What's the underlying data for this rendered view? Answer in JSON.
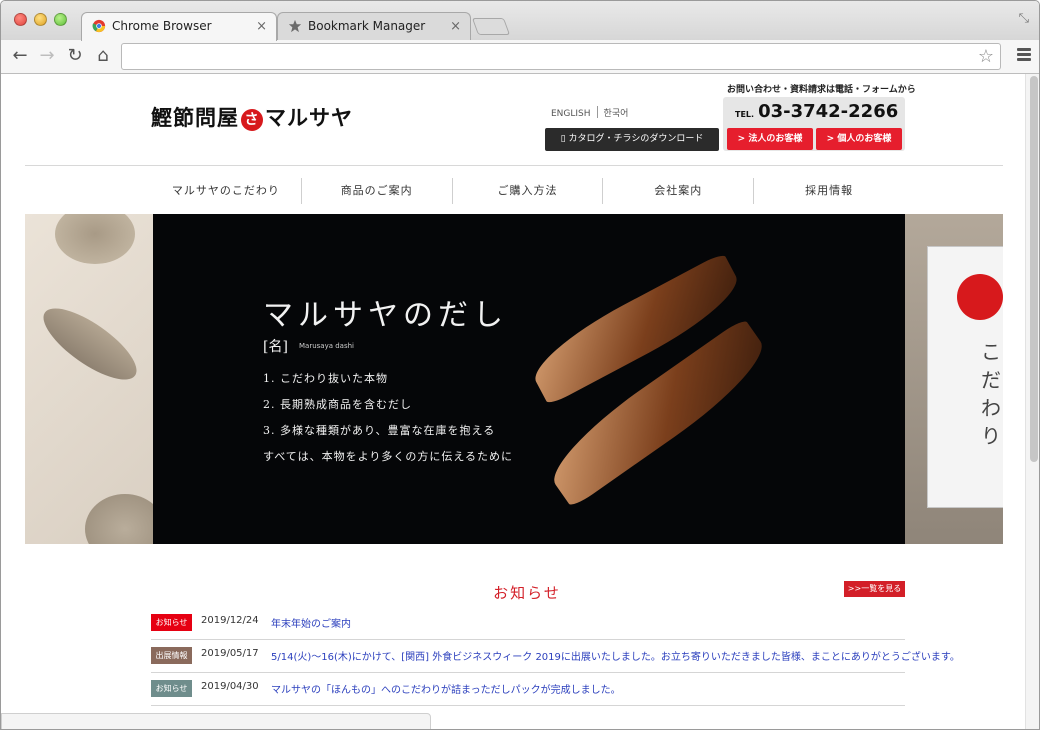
{
  "browser": {
    "tabs": [
      {
        "label": "Chrome Browser",
        "active": true
      },
      {
        "label": "Bookmark Manager",
        "active": false
      }
    ],
    "tab_close_glyph": "×",
    "url": "",
    "nav_icons": {
      "back": "←",
      "forward": "→",
      "reload": "↻",
      "home": "⌂",
      "star": "☆",
      "restore": "⤡"
    }
  },
  "site": {
    "logo": {
      "prefix": "鰹節問屋",
      "mark": "さ",
      "name": "マルサヤ"
    },
    "lang": {
      "english": "ENGLISH",
      "korean": "한국어"
    },
    "catalog_button": "カタログ・チラシのダウンロード",
    "contact_note": "お問い合わせ・資料請求は電話・フォームから",
    "tel_prefix": "TEL.",
    "tel": "03-3742-2266",
    "biz_button": "> 法人のお客様",
    "personal_button": "> 個人のお客様"
  },
  "nav": [
    "マルサヤのこだわり",
    "商品のご案内",
    "ご購入方法",
    "会社案内",
    "採用情報"
  ],
  "hero": {
    "title": "マルサヤのだし",
    "name": "[名]",
    "name_sub": "Marusaya dashi",
    "lines": [
      "1. こだわり抜いた本物",
      "2. 長期熟成商品を含むだし",
      "3. 多様な種類があり、豊富な在庫を抱える",
      "すべては、本物をより多くの方に伝えるために"
    ],
    "right_text": "こだわり"
  },
  "news": {
    "title": "お知らせ",
    "more": ">>一覧を見る",
    "items": [
      {
        "badge": "お知らせ",
        "color": "#e60012",
        "date": "2019/12/24",
        "text": "年末年始のご案内"
      },
      {
        "badge": "出展情報",
        "color": "#8a6a5c",
        "date": "2019/05/17",
        "text": "5/14(火)～16(木)にかけて、[関西] 外食ビジネスウィーク 2019に出展いたしました。お立ち寄りいただきました皆様、まことにありがとうございます。"
      },
      {
        "badge": "お知らせ",
        "color": "#6f8d8c",
        "date": "2019/04/30",
        "text": "マルサヤの「ほんもの」へのこだわりが詰まっただしパックが完成しました。"
      }
    ]
  }
}
